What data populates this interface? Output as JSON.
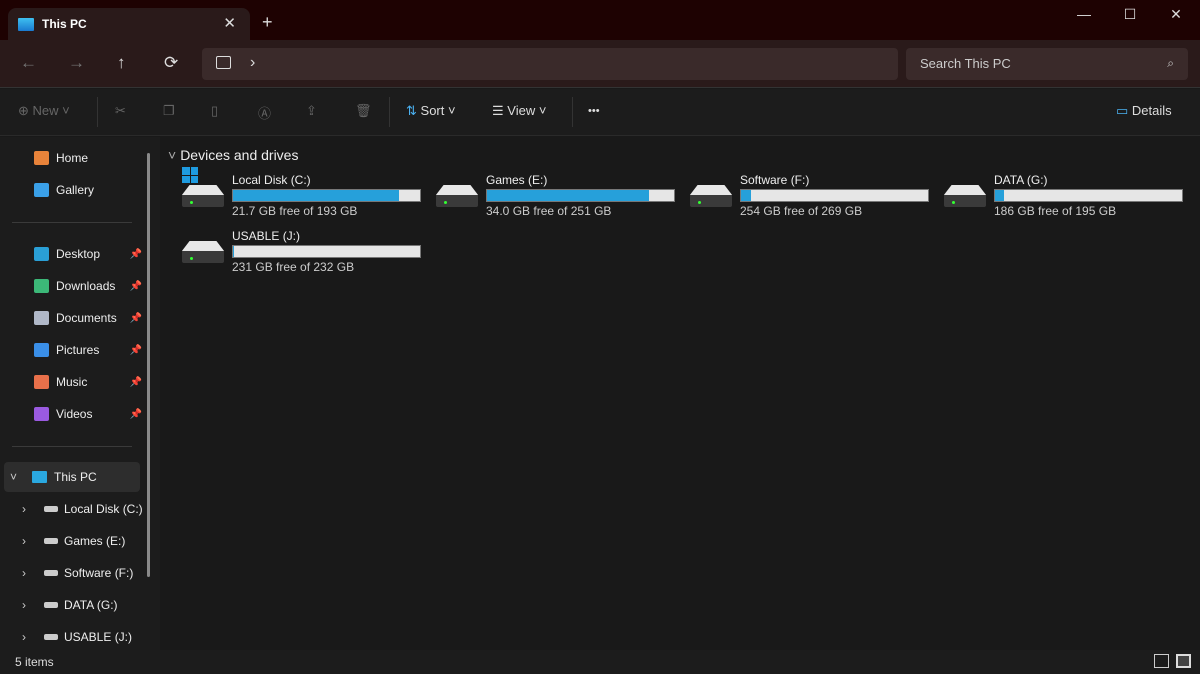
{
  "window": {
    "tab_title": "This PC",
    "new_tab": "+",
    "minimize": "—",
    "maximize": "☐",
    "close": "✕"
  },
  "nav": {
    "back": "←",
    "forward": "→",
    "up": "↑",
    "refresh": "⟳",
    "breadcrumb_sep": "›",
    "search_placeholder": "Search This PC"
  },
  "toolbar": {
    "new": "New",
    "sort": "Sort",
    "view": "View",
    "more": "•••",
    "details": "Details"
  },
  "sidebar": {
    "top": [
      {
        "label": "Home",
        "color": "#e8833a"
      },
      {
        "label": "Gallery",
        "color": "#3aa0e8"
      }
    ],
    "pinned": [
      {
        "label": "Desktop",
        "color": "#2a9fd6"
      },
      {
        "label": "Downloads",
        "color": "#3cb878"
      },
      {
        "label": "Documents",
        "color": "#b0b8c8"
      },
      {
        "label": "Pictures",
        "color": "#3a8fe8"
      },
      {
        "label": "Music",
        "color": "#e8704a"
      },
      {
        "label": "Videos",
        "color": "#9a5ae0"
      }
    ],
    "this_pc": "This PC",
    "drives": [
      "Local Disk (C:)",
      "Games (E:)",
      "Software (F:)",
      "DATA (G:)",
      "USABLE (J:)"
    ]
  },
  "content": {
    "group_title": "Devices and drives",
    "drives": [
      {
        "name": "Local Disk (C:)",
        "free": "21.7 GB free of 193 GB",
        "used_fraction": 0.888,
        "system": true
      },
      {
        "name": "Games (E:)",
        "free": "34.0 GB free of 251 GB",
        "used_fraction": 0.865
      },
      {
        "name": "Software (F:)",
        "free": "254 GB free of 269 GB",
        "used_fraction": 0.056
      },
      {
        "name": "DATA (G:)",
        "free": "186 GB free of 195 GB",
        "used_fraction": 0.046
      },
      {
        "name": "USABLE (J:)",
        "free": "231 GB free of 232 GB",
        "used_fraction": 0.004
      }
    ]
  },
  "status": {
    "items": "5 items"
  }
}
